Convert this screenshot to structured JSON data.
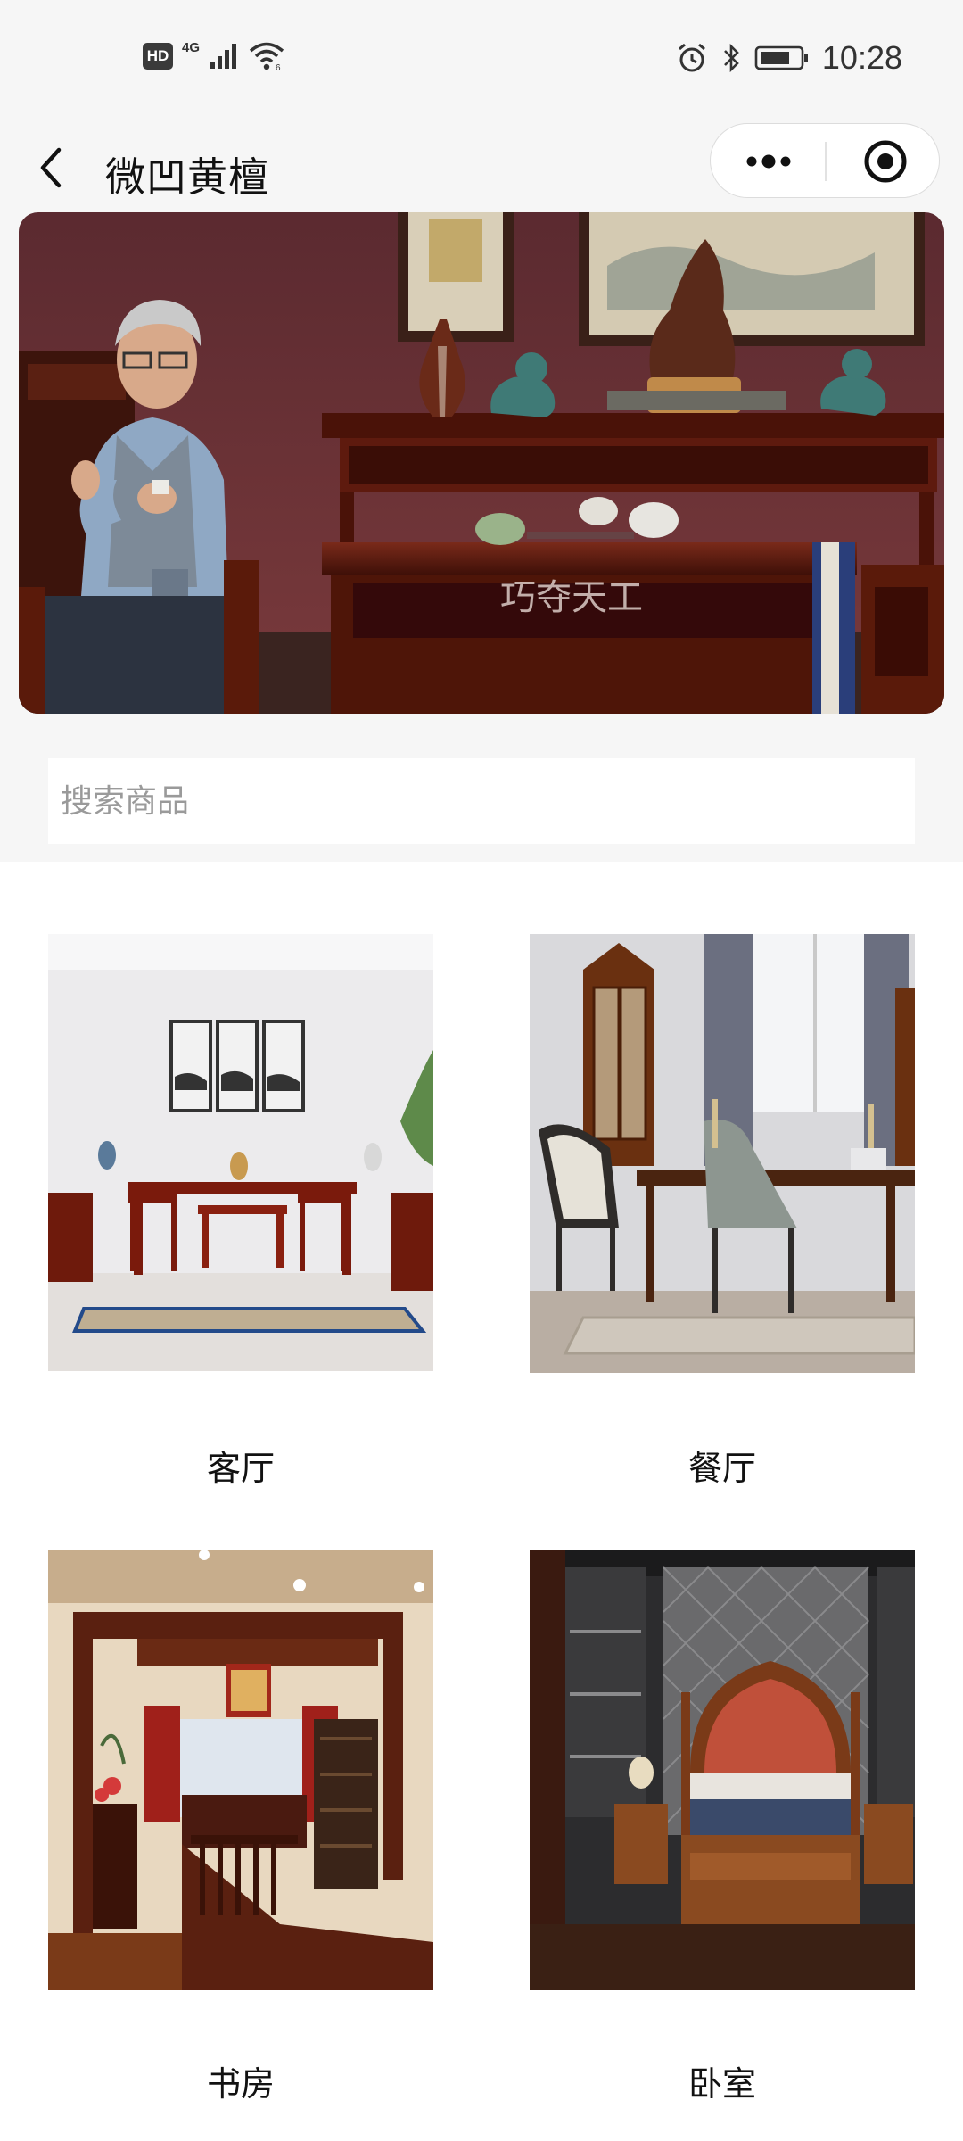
{
  "status_bar": {
    "hd": "HD",
    "network": "4G",
    "time": "10:28"
  },
  "nav": {
    "title": "微凹黄檀",
    "back_icon": "chevron-left-icon",
    "more_icon": "more-dots-icon",
    "close_icon": "target-circle-icon"
  },
  "banner": {
    "watermark": "巧夺天工"
  },
  "search": {
    "placeholder": "搜索商品",
    "value": ""
  },
  "categories": [
    {
      "label": "客厅"
    },
    {
      "label": "餐厅"
    },
    {
      "label": "书房"
    },
    {
      "label": "卧室"
    }
  ],
  "colors": {
    "background": "#f6f6f6",
    "wood": "#6b1f12",
    "wall": "#6e2f36"
  }
}
